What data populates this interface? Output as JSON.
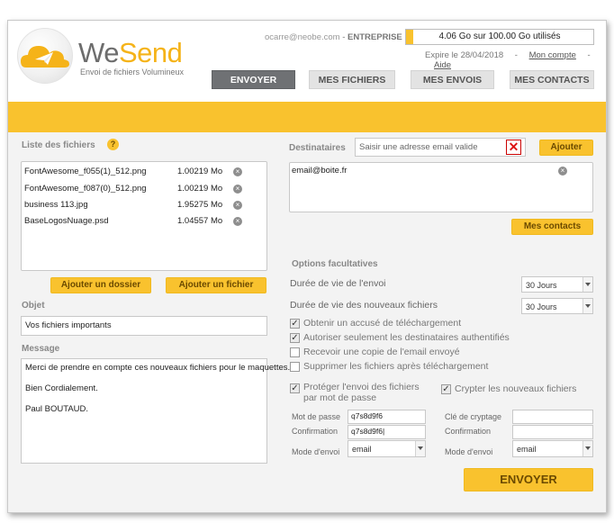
{
  "brand": {
    "name_we": "We",
    "name_send": "Send",
    "tagline": "Envoi de fichiers Volumineux"
  },
  "account": {
    "email": "ocarre@neobe.com",
    "separator": " - ",
    "type": "ENTREPRISE"
  },
  "quota": {
    "text": "4.06 Go sur 100.00 Go utilisés",
    "used_fraction": 0.0406
  },
  "expire": {
    "text": "Expire le 28/04/2018",
    "separator": "-",
    "account_link": "Mon compte",
    "help_link": "Aide"
  },
  "nav": {
    "tabs": [
      "ENVOYER",
      "MES FICHIERS",
      "MES ENVOIS",
      "MES CONTACTS"
    ],
    "active": "ENVOYER"
  },
  "files": {
    "label": "Liste des fichiers",
    "help_icon_glyph": "?",
    "items": [
      {
        "name": "FontAwesome_f055(1)_512.png",
        "size": "1.00219 Mo"
      },
      {
        "name": "FontAwesome_f087(0)_512.png",
        "size": "1.00219 Mo"
      },
      {
        "name": "business 113.jpg",
        "size": "1.95275 Mo"
      },
      {
        "name": "BaseLogosNuage.psd",
        "size": "1.04557 Mo"
      }
    ],
    "add_folder_label": "Ajouter un dossier",
    "add_file_label": "Ajouter un fichier",
    "remove_glyph": "×"
  },
  "objet": {
    "label": "Objet",
    "value": "Vos fichiers importants"
  },
  "message": {
    "label": "Message",
    "lines": [
      "Merci de prendre en compte ces nouveaux fichiers pour le maquettes.",
      "Bien Cordialement.",
      "Paul BOUTAUD."
    ]
  },
  "recipients": {
    "label": "Destinataires",
    "placeholder": "Saisir une adresse email valide",
    "clear_glyph": "✕",
    "add_label": "Ajouter",
    "items": [
      "email@boite.fr"
    ],
    "contacts_label": "Mes contacts"
  },
  "options": {
    "title": "Options facultatives",
    "lifetime_label": "Durée de vie de l'envoi",
    "lifetime_value": "30 Jours",
    "new_files_lifetime_label": "Durée de vie des nouveaux fichiers",
    "new_files_lifetime_value": "30 Jours",
    "checks": [
      {
        "label": "Obtenir un accusé de téléchargement",
        "checked": true
      },
      {
        "label": "Autoriser seulement les destinataires authentifiés",
        "checked": true
      },
      {
        "label": "Recevoir une copie de l'email envoyé",
        "checked": false
      },
      {
        "label": "Supprimer les fichiers après téléchargement",
        "checked": false
      }
    ],
    "protect_label_line1": "Protéger l'envoi des fichiers",
    "protect_label_line2": "par mot de passe",
    "protect_checked": true,
    "crypt_label": "Crypter les nouveaux fichiers",
    "crypt_checked": true,
    "password_label": "Mot de passe",
    "password_value": "q7s8d9f6",
    "confirm_label": "Confirmation",
    "confirm_value": "q7s8d9f6|",
    "mode_label": "Mode d'envoi",
    "mode_value": "email",
    "key_label": "Clé de cryptage",
    "key_value": "",
    "key_confirm_label": "Confirmation",
    "key_confirm_value": "",
    "key_mode_label": "Mode d'envoi",
    "key_mode_value": "email",
    "check_glyph": "✓"
  },
  "submit_label": "ENVOYER",
  "colors": {
    "accent": "#f9c22e",
    "active_tab": "#6f7174",
    "brand_grey": "#6d6d6d",
    "brand_yellow": "#f5b319"
  }
}
